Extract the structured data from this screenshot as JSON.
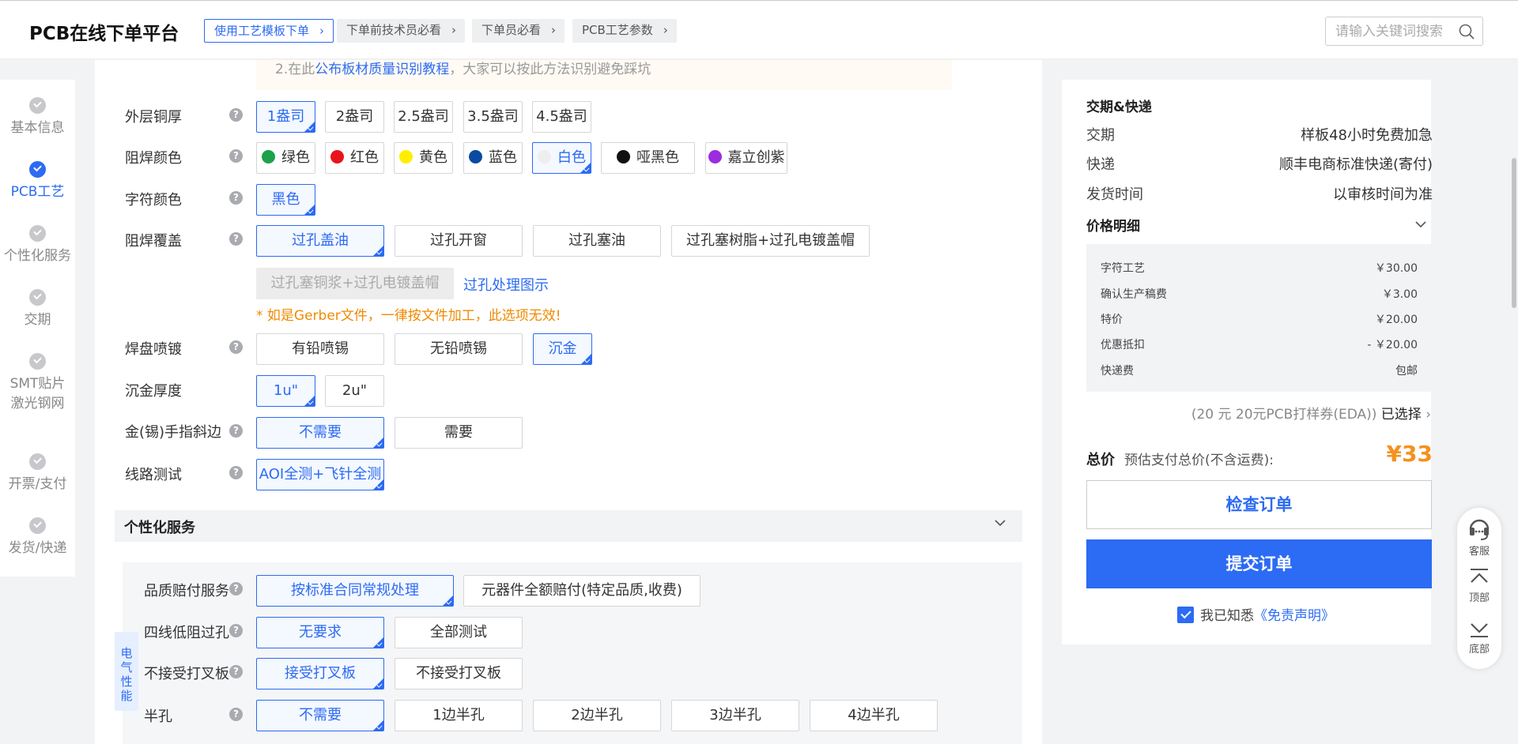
{
  "header": {
    "logo": "PCB在线下单平台",
    "btn_template": "使用工艺模板下单",
    "btn_tech": "下单前技术员必看",
    "btn_orderer": "下单员必看",
    "btn_params": "PCB工艺参数",
    "search_placeholder": "请输入关键词搜索"
  },
  "steps": [
    "基本信息",
    "PCB工艺",
    "个性化服务",
    "交期",
    "SMT贴片",
    "激光钢网",
    "开票/支付",
    "发货/快递"
  ],
  "notice": {
    "prefix": "2.在此",
    "link": "公布板材质量识别教程",
    "suffix": "，大家可以按此方法识别避免踩坑"
  },
  "form": {
    "outer_copper": {
      "label": "外层铜厚",
      "options": [
        "1盎司",
        "2盎司",
        "2.5盎司",
        "3.5盎司",
        "4.5盎司"
      ],
      "selected": "1盎司"
    },
    "solder_color": {
      "label": "阻焊颜色",
      "options": [
        "绿色",
        "红色",
        "黄色",
        "蓝色",
        "白色",
        "哑黑色",
        "嘉立创紫"
      ],
      "colors": [
        "#1ba24a",
        "#e8141b",
        "#ffee00",
        "#0a4aa0",
        "#eeeeee",
        "#111111",
        "#9b2ce0"
      ],
      "selected": "白色"
    },
    "silk_color": {
      "label": "字符颜色",
      "options": [
        "黑色"
      ],
      "selected": "黑色"
    },
    "via_cover": {
      "label": "阻焊覆盖",
      "options": [
        "过孔盖油",
        "过孔开窗",
        "过孔塞油",
        "过孔塞树脂+过孔电镀盖帽"
      ],
      "disabled_option": "过孔塞铜浆+过孔电镀盖帽",
      "link": "过孔处理图示",
      "warning": "* 如是Gerber文件，一律按文件加工，此选项无效!",
      "selected": "过孔盖油"
    },
    "surface": {
      "label": "焊盘喷镀",
      "options": [
        "有铅喷锡",
        "无铅喷锡",
        "沉金"
      ],
      "selected": "沉金"
    },
    "gold_thickness": {
      "label": "沉金厚度",
      "options": [
        "1u\"",
        "2u\""
      ],
      "selected": "1u\""
    },
    "gold_finger": {
      "label": "金(锡)手指斜边",
      "options": [
        "不需要",
        "需要"
      ],
      "selected": "不需要"
    },
    "test": {
      "label": "线路测试",
      "options": [
        "AOI全测+飞针全测"
      ],
      "selected": "AOI全测+飞针全测"
    }
  },
  "personal": {
    "title": "个性化服务",
    "side_tag": "电气性能",
    "quality": {
      "label": "品质赔付服务",
      "options": [
        "按标准合同常规处理",
        "元器件全额赔付(特定品质,收费)"
      ],
      "selected": "按标准合同常规处理"
    },
    "four_wire": {
      "label": "四线低阻过孔",
      "options": [
        "无要求",
        "全部测试"
      ],
      "selected": "无要求"
    },
    "x_board": {
      "label": "不接受打叉板",
      "options": [
        "接受打叉板",
        "不接受打叉板"
      ],
      "selected": "接受打叉板"
    },
    "half_hole": {
      "label": "半孔",
      "options": [
        "不需要",
        "1边半孔",
        "2边半孔",
        "3边半孔",
        "4边半孔"
      ],
      "selected": "不需要"
    }
  },
  "summary": {
    "delivery_title": "交期&快递",
    "lead_k": "交期",
    "lead_v": "样板48小时免费加急",
    "express_k": "快递",
    "express_v": "顺丰电商标准快递(寄付)",
    "ship_k": "发货时间",
    "ship_v": "以审核时间为准",
    "price_title": "价格明细",
    "price_rows": [
      {
        "k": "字符工艺",
        "v": "￥30.00"
      },
      {
        "k": "确认生产稿费",
        "v": "￥3.00"
      },
      {
        "k": "特价",
        "v": "￥20.00"
      },
      {
        "k": "优惠抵扣",
        "v": "- ￥20.00"
      },
      {
        "k": "快递费",
        "v": "包邮"
      }
    ],
    "coupon_text": "(20 元 20元PCB打样券(EDA))",
    "coupon_selected": "已选择",
    "total_k": "总价",
    "total_sub": "预估支付总价(不含运费):",
    "total_v": "¥33",
    "btn_check": "检查订单",
    "btn_submit": "提交订单",
    "agree_text": "我已知悉",
    "agree_link": "《免责声明》"
  },
  "floattools": {
    "service": "客服",
    "top": "顶部",
    "bottom": "底部"
  },
  "accent": "#2c6bf3",
  "price_color": "#f5911d",
  "warning_color": "#f08a00"
}
